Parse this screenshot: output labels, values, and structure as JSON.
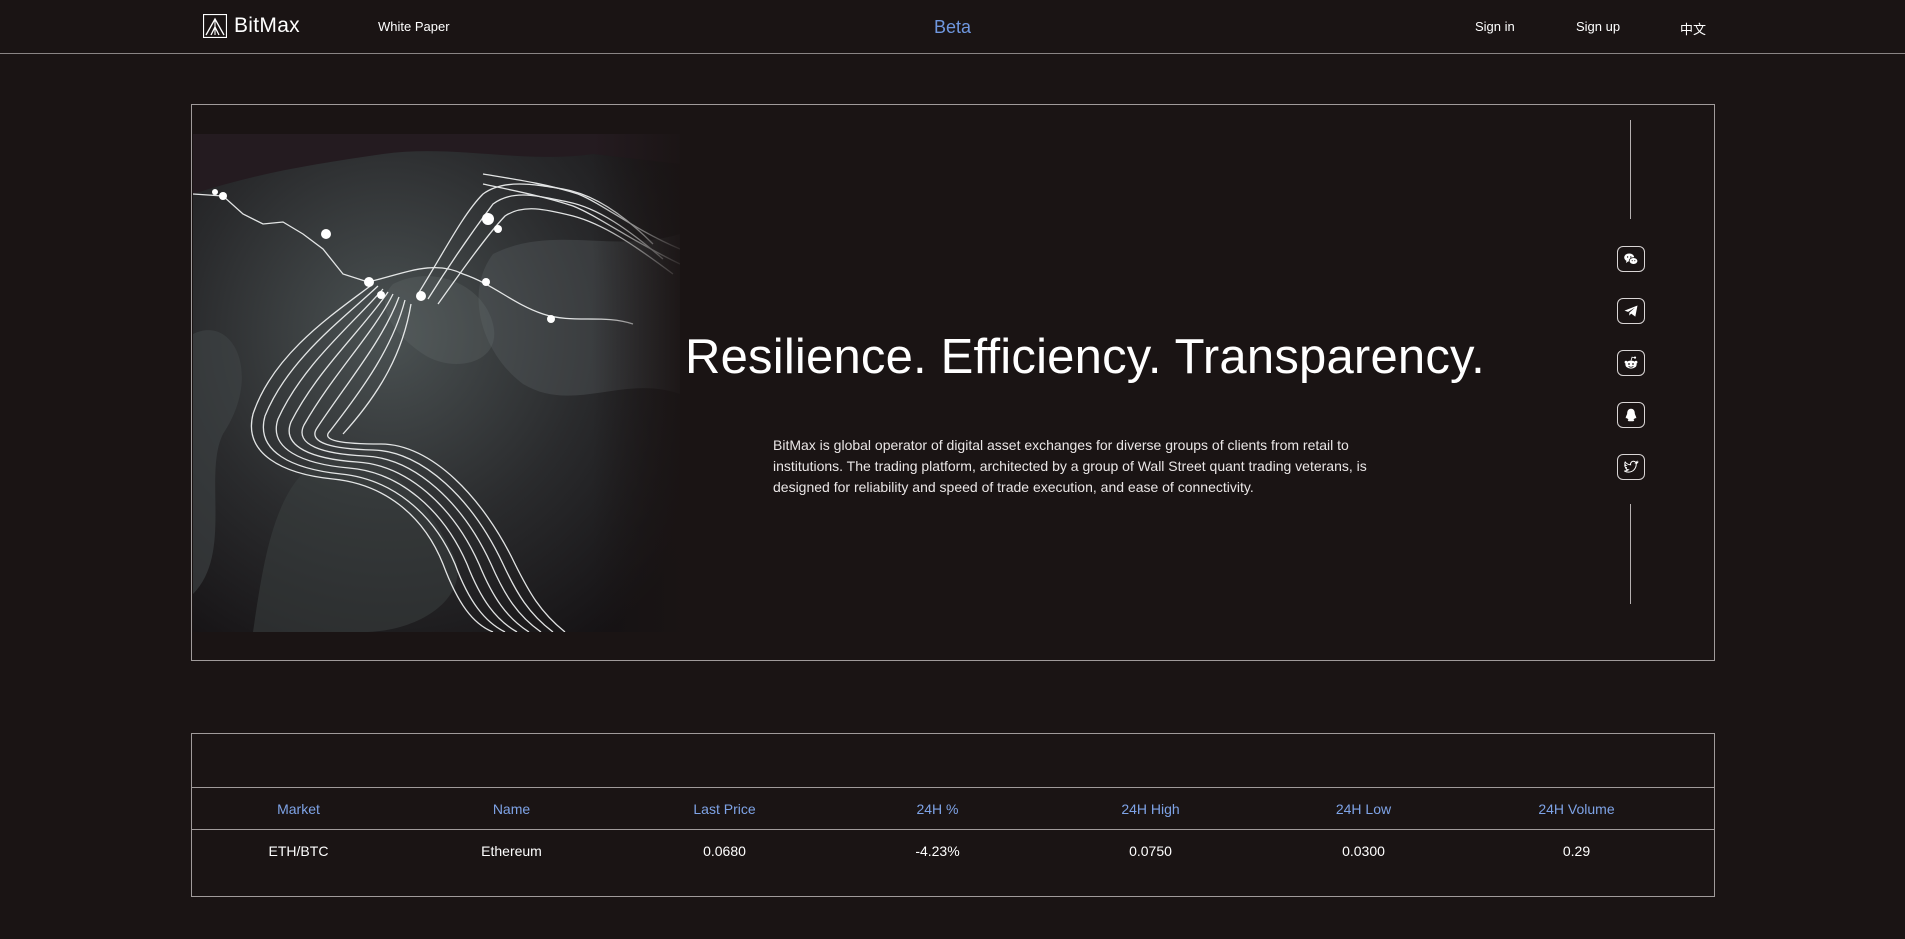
{
  "nav": {
    "brand": "BitMax",
    "white_paper": "White Paper",
    "beta": "Beta",
    "sign_in": "Sign in",
    "sign_up": "Sign up",
    "language": "中文"
  },
  "hero": {
    "headline": "Resilience. Efficiency. Transparency.",
    "description": "BitMax is global operator of digital asset exchanges for diverse groups of clients from retail to institutions. The trading platform, architected by a group of Wall Street quant trading veterans, is designed for reliability and speed of trade execution, and ease of connectivity.",
    "social_icons": [
      "wechat-icon",
      "telegram-icon",
      "reddit-icon",
      "qq-icon",
      "twitter-icon"
    ]
  },
  "market": {
    "columns": [
      "Market",
      "Name",
      "Last Price",
      "24H %",
      "24H High",
      "24H Low",
      "24H Volume"
    ],
    "rows": [
      [
        "ETH/BTC",
        "Ethereum",
        "0.0680",
        "-4.23%",
        "0.0750",
        "0.0300",
        "0.29"
      ]
    ]
  },
  "colors": {
    "background": "#1a1414",
    "accent": "#6f97df",
    "table_header": "#7ea3e6",
    "border": "#a09b9b"
  }
}
